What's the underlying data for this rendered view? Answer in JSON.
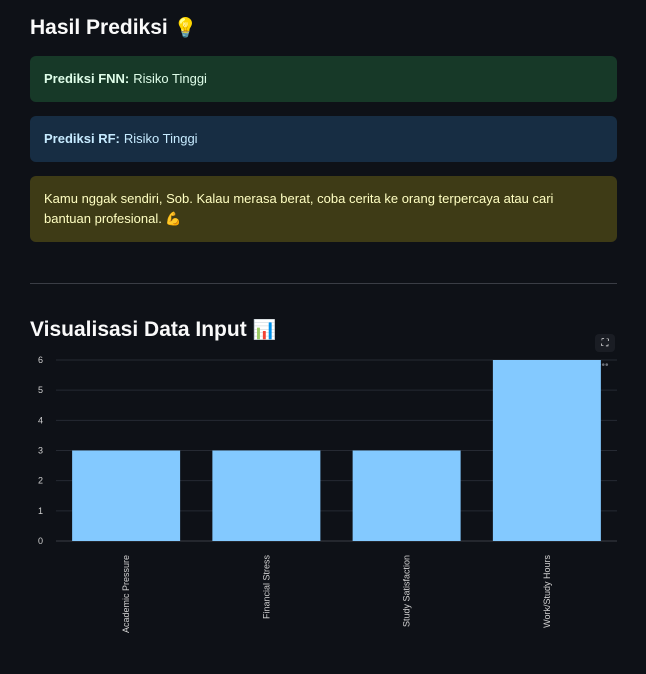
{
  "results": {
    "title": "Hasil Prediksi",
    "title_icon": "💡",
    "fnn": {
      "label": "Prediksi FNN:",
      "value": "Risiko Tinggi",
      "color": "#173928"
    },
    "rf": {
      "label": "Prediksi RF:",
      "value": "Risiko Tinggi",
      "color": "#172d43"
    },
    "message": "Kamu nggak sendiri, Sob. Kalau merasa berat, coba cerita ke orang terpercaya atau cari bantuan profesional. 💪",
    "message_color": "#3e3b16"
  },
  "visualization": {
    "title": "Visualisasi Data Input",
    "title_icon": "📊",
    "fullscreen_icon": "fullscreen-icon",
    "menu_icon": "more-icon"
  },
  "chart_data": {
    "type": "bar",
    "categories": [
      "Academic Pressure",
      "Financial Stress",
      "Study Satisfaction",
      "Work/Study Hours"
    ],
    "values": [
      3,
      3,
      3,
      6
    ],
    "yticks": [
      0,
      1,
      2,
      3,
      4,
      5,
      6
    ],
    "ylim": [
      0,
      6
    ],
    "bar_color": "#83c9ff",
    "grid": true,
    "title": "",
    "xlabel": "",
    "ylabel": ""
  }
}
